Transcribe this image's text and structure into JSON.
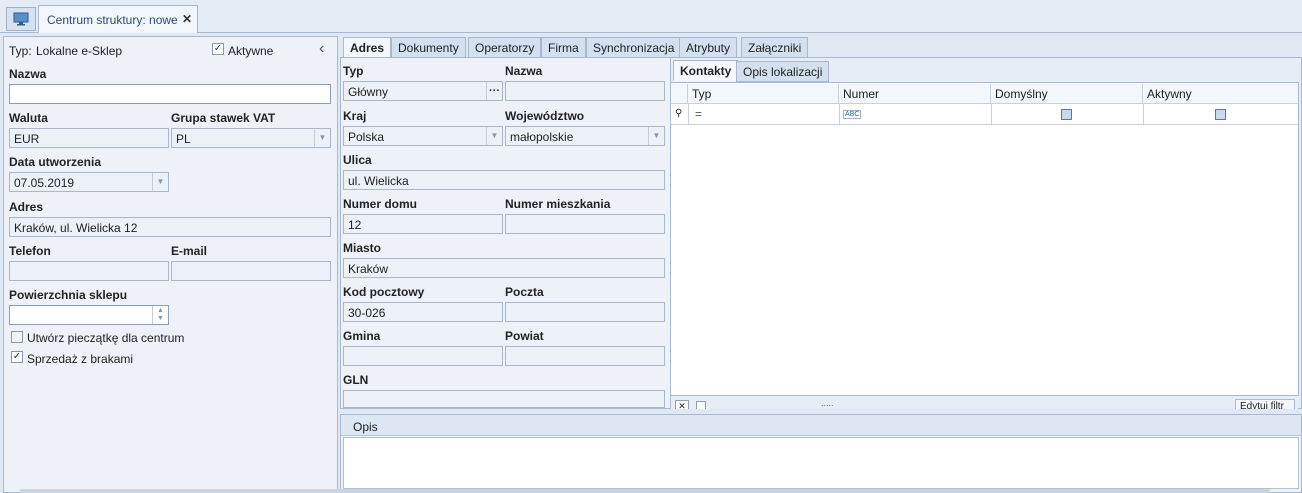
{
  "doc_tab": {
    "title": "Centrum struktury: nowe",
    "close": "✕"
  },
  "left": {
    "typ_label": "Typ:",
    "typ_value": "Lokalne e-Sklep",
    "aktywne_label": "Aktywne",
    "collapse": "‹",
    "nazwa_label": "Nazwa",
    "nazwa_value": "",
    "waluta_label": "Waluta",
    "waluta_value": "EUR",
    "grupa_label": "Grupa stawek VAT",
    "grupa_value": "PL",
    "data_label": "Data utworzenia",
    "data_value": "07.05.2019",
    "adres_label": "Adres",
    "adres_value": "Kraków, ul. Wielicka 12",
    "telefon_label": "Telefon",
    "telefon_value": "",
    "email_label": "E-mail",
    "email_value": "",
    "powierzchnia_label": "Powierzchnia sklepu",
    "powierzchnia_value": "",
    "pieczatka_label": "Utwórz pieczątkę dla centrum",
    "sprzedaz_label": "Sprzedaż z brakami"
  },
  "tabs": [
    "Adres",
    "Dokumenty",
    "Operatorzy",
    "Firma",
    "Synchronizacja",
    "Atrybuty",
    "Załączniki"
  ],
  "address": {
    "typ_label": "Typ",
    "typ_value": "Główny",
    "typ_btn": "···",
    "nazwa_label": "Nazwa",
    "nazwa_value": "",
    "kraj_label": "Kraj",
    "kraj_value": "Polska",
    "woj_label": "Województwo",
    "woj_value": "małopolskie",
    "ulica_label": "Ulica",
    "ulica_value": "ul. Wielicka",
    "dom_label": "Numer domu",
    "dom_value": "12",
    "mieszk_label": "Numer mieszkania",
    "mieszk_value": "",
    "miasto_label": "Miasto",
    "miasto_value": "Kraków",
    "kod_label": "Kod pocztowy",
    "kod_value": "30-026",
    "poczta_label": "Poczta",
    "poczta_value": "",
    "gmina_label": "Gmina",
    "gmina_value": "",
    "powiat_label": "Powiat",
    "powiat_value": "",
    "gln_label": "GLN",
    "gln_value": ""
  },
  "subtabs": [
    "Kontakty",
    "Opis lokalizacji"
  ],
  "grid": {
    "columns": [
      "Typ",
      "Numer",
      "Domyślny",
      "Aktywny"
    ],
    "filter_row": {
      "typ": "=",
      "numer": "ABC"
    },
    "footer_button": "Edytuj filtr",
    "dots": "....."
  },
  "opis": {
    "label": "Opis",
    "value": ""
  },
  "icons": {
    "doc": "monitor-icon",
    "check": "✓"
  }
}
